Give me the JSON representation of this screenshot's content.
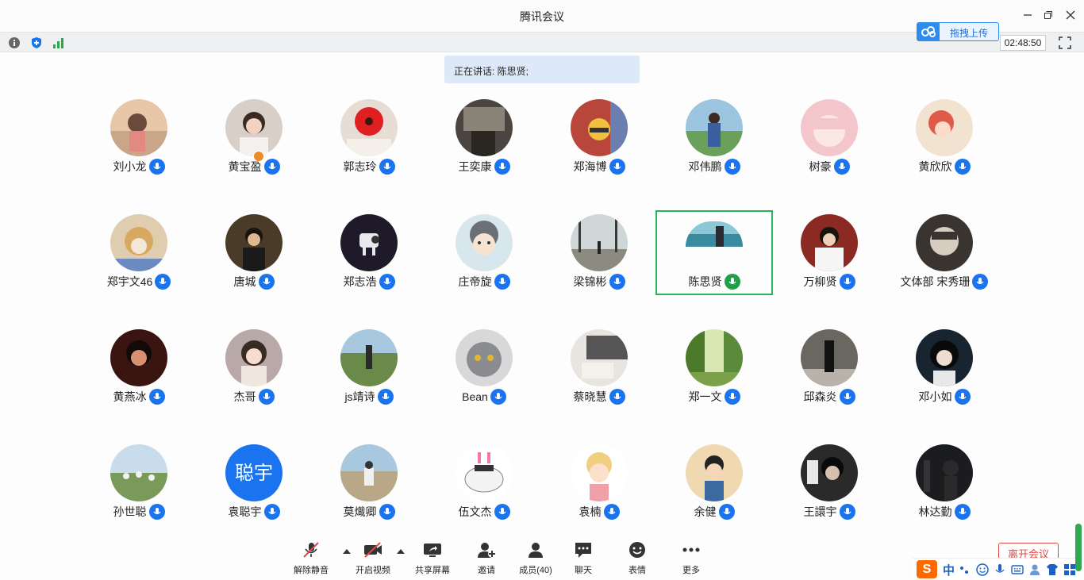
{
  "window": {
    "title": "腾讯会议"
  },
  "infobar": {
    "timer": "02:48:50",
    "icons": [
      "info-icon",
      "shield-icon",
      "signal-icon",
      "fullscreen-icon"
    ]
  },
  "upload": {
    "label": "拖拽上传"
  },
  "speaking": {
    "text": "正在讲话: 陈思贤;"
  },
  "participants": [
    {
      "name": "刘小龙"
    },
    {
      "name": "黄宝盈"
    },
    {
      "name": "郭志玲"
    },
    {
      "name": "王奕康"
    },
    {
      "name": "郑海博"
    },
    {
      "name": "邓伟鹏"
    },
    {
      "name": "树豪"
    },
    {
      "name": "黄欣欣"
    },
    {
      "name": "郑宇文46"
    },
    {
      "name": "唐城"
    },
    {
      "name": "郑志浩"
    },
    {
      "name": "庄帝旋"
    },
    {
      "name": "梁锦彬"
    },
    {
      "name": "陈思贤"
    },
    {
      "name": "万柳贤"
    },
    {
      "name": "文体部 宋秀珊"
    },
    {
      "name": "黄燕冰"
    },
    {
      "name": "杰哥"
    },
    {
      "name": "js靖诗"
    },
    {
      "name": "Bean"
    },
    {
      "name": "蔡晓慧"
    },
    {
      "name": "郑一文"
    },
    {
      "name": "邱森炎"
    },
    {
      "name": "邓小如"
    },
    {
      "name": "孙世聪"
    },
    {
      "name": "袁聪宇",
      "avatar_text": "聪宇"
    },
    {
      "name": "莫熾卿"
    },
    {
      "name": "伍文杰"
    },
    {
      "name": "袁楠"
    },
    {
      "name": "余健"
    },
    {
      "name": "王譞宇"
    },
    {
      "name": "林达勤"
    }
  ],
  "toolbar": {
    "unmute": "解除静音",
    "video": "开启视频",
    "share": "共享屏幕",
    "invite": "邀请",
    "members": "成员(40)",
    "chat": "聊天",
    "emoji": "表情",
    "more": "更多",
    "leave": "离开会议"
  },
  "ime": {
    "zh": "中"
  },
  "colors": {
    "accent": "#1a74f0",
    "speaking_frame": "#27b35c",
    "leave": "#e04848"
  }
}
